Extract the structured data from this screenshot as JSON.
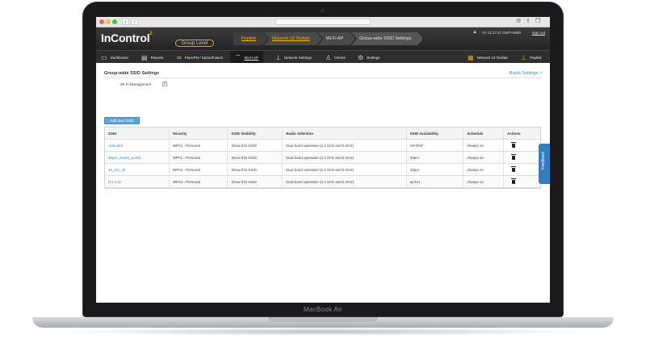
{
  "device": {
    "label": "MacBook Air"
  },
  "browser": {
    "back": "‹",
    "forward": "›",
    "menu_icon": "gear-icon"
  },
  "app": {
    "logo": "InControl",
    "logo_sup": "2",
    "group_level": "Group Level",
    "breadcrumbs": [
      "Peplink",
      "Network 13 Testlab",
      "Wi-Fi AP",
      "Group-wide SSID Settings"
    ],
    "clock": "Fri 11:17:47 GMT+0000",
    "sign_out": "Sign out"
  },
  "menu": {
    "items": [
      "Dashboard",
      "Reports",
      "PepVPN / SpeedFusion",
      "Wi-Fi AP",
      "Network Settings",
      "Clients",
      "Settings"
    ],
    "right_items": [
      "Network 13 Testlab",
      "Peplink"
    ]
  },
  "page": {
    "title": "Group-wide SSID Settings",
    "radio_link": "Radio Settings >",
    "wifi_management_label": "Wi-Fi Management",
    "wifi_management_checked": "✓",
    "add_button": "Add new SSID",
    "feedback": "Feedback"
  },
  "table": {
    "columns": [
      "SSID",
      "Security",
      "SSID Visibility",
      "Radio Selection",
      "SSID Availability",
      "Schedule",
      "Actions"
    ],
    "rows": [
      [
        "unlimited",
        "WPA2 - Personal",
        "Show this SSID",
        "Dual band operation (2.4 GHz and 5 GHz)",
        "AP-ENT",
        "Always on"
      ],
      [
        "30pro_Guest_portal",
        "WPA2 - Personal",
        "Show this SSID",
        "Dual band operation (2.4 GHz and 5 GHz)",
        "30pro",
        "Always on"
      ],
      [
        "30_pro_all",
        "WPA2 - Personal",
        "Show this SSID",
        "Dual band operation (2.4 GHz and 5 GHz)",
        "30pro",
        "Always on"
      ],
      [
        "br1-mini",
        "WPA2 - Personal",
        "Show this SSID",
        "Dual band operation (2.4 GHz and 5 GHz)",
        "ap-br1",
        "Always on"
      ]
    ]
  },
  "colors": {
    "accent": "#2f8fd0",
    "header": "#2e2e2e",
    "brand_gold": "#f0b400"
  }
}
